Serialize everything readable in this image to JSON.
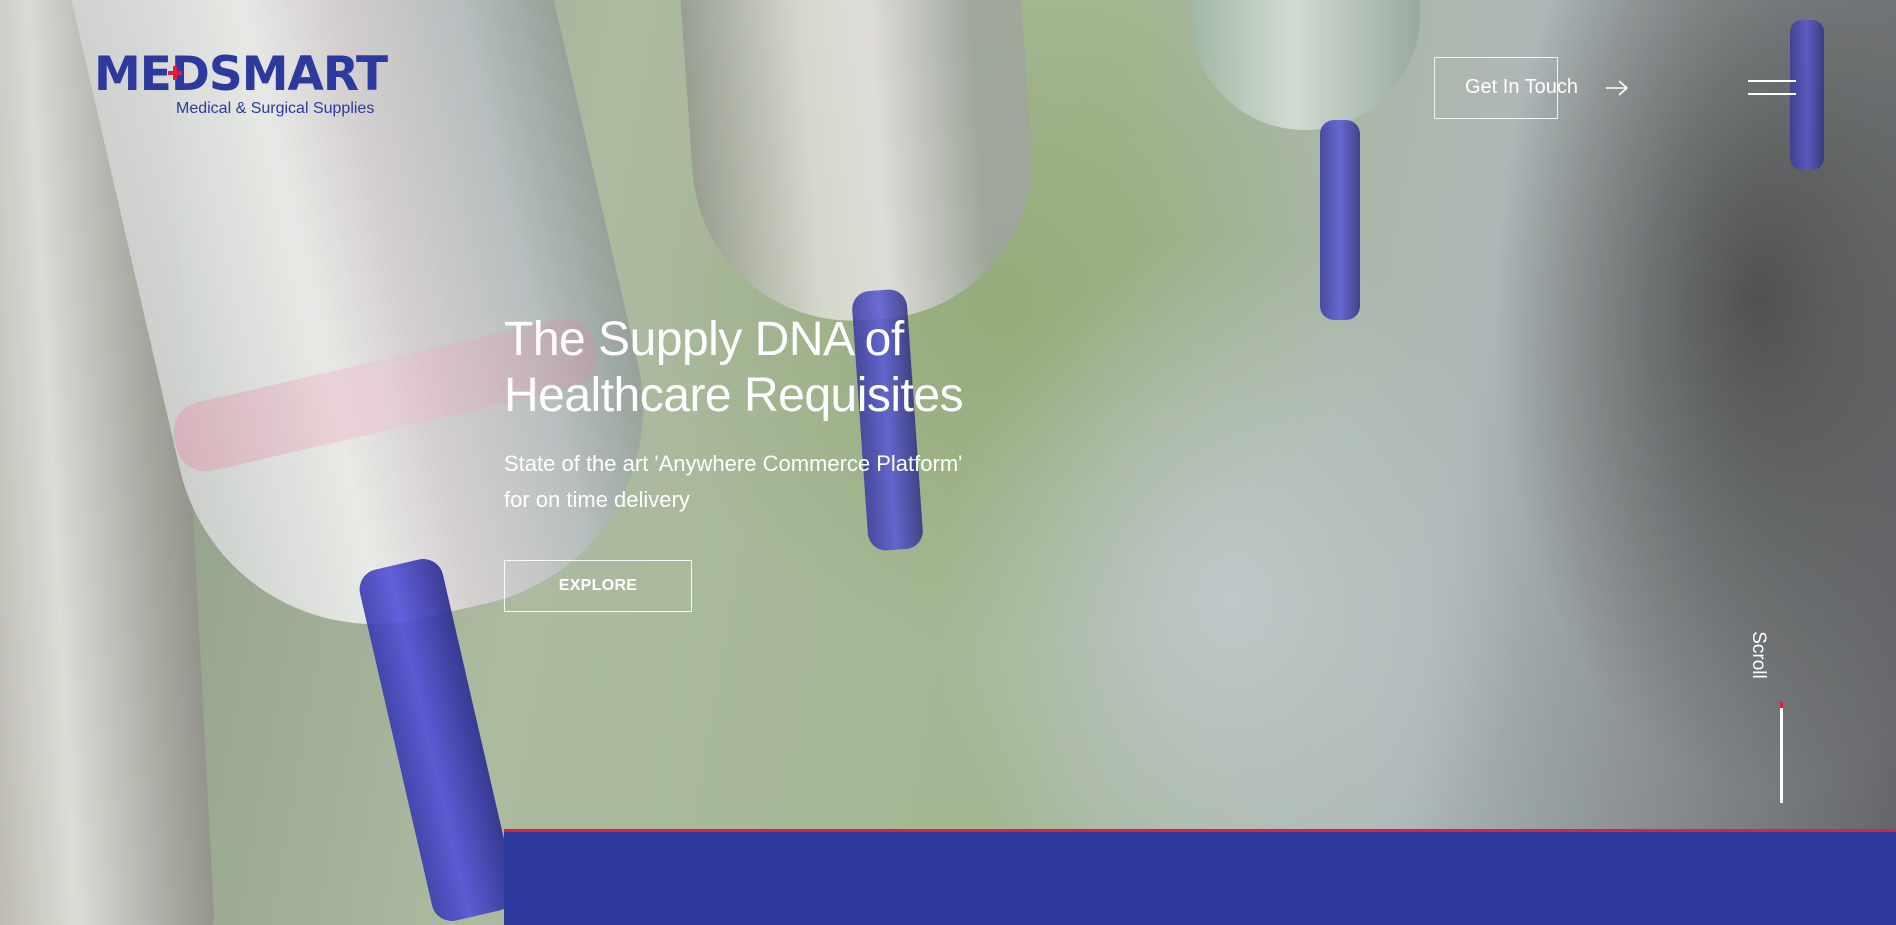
{
  "brand": {
    "name": "MEDSMART",
    "tagline": "Medical & Surgical Supplies",
    "primary_color": "#2c3a9e",
    "accent_color": "#e0203a"
  },
  "header": {
    "contact_label": "Get In Touch",
    "contact_icon": "arrow-right-icon",
    "menu_icon": "hamburger-menu-icon"
  },
  "hero": {
    "title_line1": "The Supply DNA of",
    "title_line2": "Healthcare Requisites",
    "subtitle_line1": "State of the art 'Anywhere Commerce Platform'",
    "subtitle_line2": "for on time delivery",
    "cta_label": "EXPLORE",
    "text_color": "#ffffff"
  },
  "scroll": {
    "label": "Scroll"
  },
  "footer_band": {
    "color": "#2b3a9b",
    "border_color": "#d9243b"
  }
}
